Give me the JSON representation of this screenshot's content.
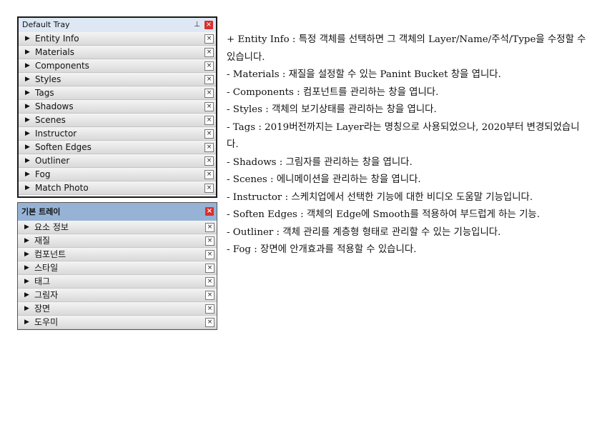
{
  "tray_en": {
    "title": "Default Tray",
    "pin_icon": "push-pin-icon",
    "close_icon": "close-icon",
    "items": [
      {
        "label": "Entity Info"
      },
      {
        "label": "Materials"
      },
      {
        "label": "Components"
      },
      {
        "label": "Styles"
      },
      {
        "label": "Tags"
      },
      {
        "label": "Shadows"
      },
      {
        "label": "Scenes"
      },
      {
        "label": "Instructor"
      },
      {
        "label": "Soften Edges"
      },
      {
        "label": "Outliner"
      },
      {
        "label": "Fog"
      },
      {
        "label": "Match Photo"
      }
    ]
  },
  "tray_ko": {
    "title": "기본 트레이",
    "close_icon": "close-icon",
    "items": [
      {
        "label": "요소 정보"
      },
      {
        "label": "재질"
      },
      {
        "label": "컴포넌트"
      },
      {
        "label": "스타일"
      },
      {
        "label": "태그"
      },
      {
        "label": "그림자"
      },
      {
        "label": "장면"
      },
      {
        "label": "도우미"
      }
    ]
  },
  "glyphs": {
    "arrow": "▶",
    "x": "×",
    "pin": "📌"
  },
  "descriptions": [
    "+ Entity Info : 특정 객체를 선택하면 그 객체의 Layer/Name/주석/Type을 수정할 수 있습니다.",
    "- Materials : 재질을 설정할 수 있는 Panint Bucket 창을 엽니다.",
    "- Components : 컴포넌트를 관리하는 창을 엽니다.",
    "- Styles : 객체의 보기상태를 관리하는 창을 엽니다.",
    "- Tags : 2019버전까지는 Layer라는 명칭으로 사용되었으나, 2020부터 변경되었습니다.",
    "- Shadows : 그림자를 관리하는 창을 엽니다.",
    "- Scenes : 에니메이션을 관리하는 창을 엽니다.",
    "- Instructor : 스케치업에서 선택한 기능에 대한 비디오 도움말 기능입니다.",
    "- Soften Edges : 객체의 Edge에 Smooth를 적용하여 부드럽게 하는 기능.",
    "- Outliner : 객체 관리를 계층형 형태로 관리할 수 있는 기능입니다.",
    "- Fog : 장면에 안개효과를 적용할 수 있습니다."
  ]
}
